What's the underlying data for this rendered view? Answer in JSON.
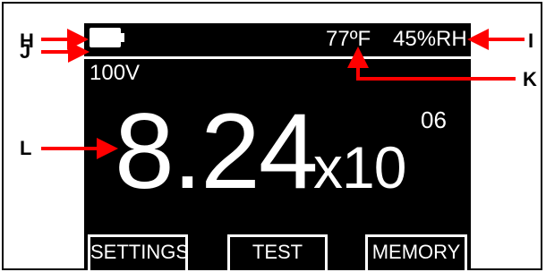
{
  "status_bar": {
    "battery_icon": "battery-full-icon",
    "temperature": "77ºF",
    "humidity": "45%RH"
  },
  "voltage": "100V",
  "measurement": {
    "mantissa": "8.24",
    "multiplier": "x10",
    "exponent": "06"
  },
  "softkeys": {
    "settings": "SETTINGS",
    "test": "TEST",
    "memory": "MEMORY"
  },
  "callouts": {
    "h": "H",
    "i": "I",
    "j": "J",
    "k": "K",
    "l": "L"
  },
  "colors": {
    "screen_background": "#000000",
    "screen_foreground": "#ffffff",
    "callout_arrows": "#ff0000"
  }
}
